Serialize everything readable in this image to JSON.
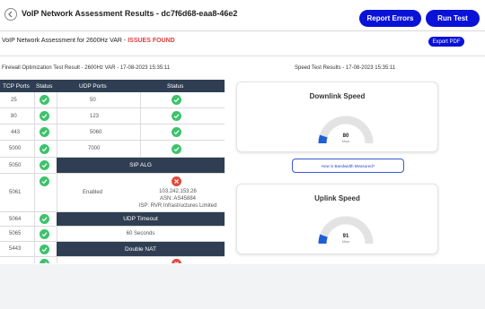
{
  "header": {
    "title": "VoIP Network Assessment Results - dc7f6d68-eaa8-46e2",
    "report_errors_label": "Report Errors",
    "run_test_label": "Run Test"
  },
  "summary": {
    "subtitle": "VoIP Network Assessment for 2600Hz VAR - ",
    "status": "ISSUES FOUND",
    "export_label": "Export PDF"
  },
  "firewall": {
    "title": "Firewall Optimization Test Result - 2600Hz VAR - 17-08-2023 15:35:11",
    "headers": {
      "tcp": "TCP Ports",
      "status": "Status",
      "udp": "UDP Ports",
      "udp_status": "Status"
    },
    "rows": [
      {
        "tcp": "25",
        "udp": "50"
      },
      {
        "tcp": "80",
        "udp": "123"
      },
      {
        "tcp": "443",
        "udp": "5060"
      },
      {
        "tcp": "5000",
        "udp": "7000"
      },
      {
        "tcp": "5050"
      },
      {
        "tcp": "5061"
      },
      {
        "tcp": "5064"
      },
      {
        "tcp": "5065"
      },
      {
        "tcp": "5443"
      }
    ],
    "sip_alg": {
      "label": "SIP ALG",
      "value": "Enabled",
      "ip": "103.242.153.26",
      "asn": "ASN: AS45884",
      "isp": "ISP: RVR Infrastructures Limited"
    },
    "udp_timeout": {
      "label": "UDP Timeout",
      "value": "60 Seconds"
    },
    "double_nat": {
      "label": "Double NAT"
    }
  },
  "speed": {
    "title": "Speed Test Results - 17-08-2023 15:35:11",
    "downlink": {
      "label": "Downlink Speed",
      "value": "80",
      "unit": "Mbps",
      "level": 0.1
    },
    "uplink": {
      "label": "Uplink Speed",
      "value": "91",
      "unit": "Mbps",
      "level": 0.11
    },
    "how_label": "How is Bandwidth Measured?"
  },
  "colors": {
    "accent": "#0a12d8",
    "header_dark": "#2f3e53",
    "ok": "#3cc26b",
    "error": "#e2493b",
    "issues": "#e23d3d"
  },
  "icons": {
    "back": "back-icon",
    "check": "check-icon",
    "error": "close-icon"
  }
}
